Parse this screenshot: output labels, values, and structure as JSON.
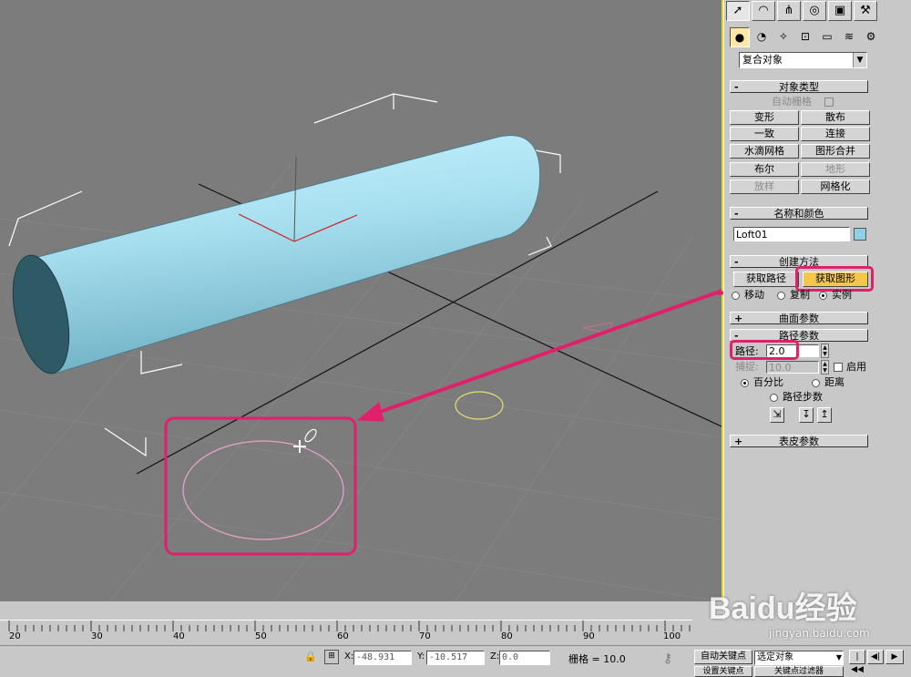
{
  "panel": {
    "tabs": [
      "create-icon",
      "modify-icon",
      "hierarchy-icon",
      "motion-icon",
      "display-icon",
      "utilities-icon"
    ],
    "subcategory_icons": [
      "geometry-icon",
      "shapes-icon",
      "lights-icon",
      "cameras-icon",
      "helpers-icon",
      "spacewarps-icon",
      "systems-icon"
    ],
    "category_dropdown": "复合对象",
    "object_type": {
      "title": "对象类型",
      "auto_grid": "自动栅格",
      "buttons": [
        "变形",
        "散布",
        "一致",
        "连接",
        "水滴网格",
        "图形合并",
        "布尔",
        "地形",
        "放样",
        "网格化"
      ]
    },
    "name_color": {
      "title": "名称和颜色",
      "name_value": "Loft01",
      "color": "#8fd0e8"
    },
    "creation_method": {
      "title": "创建方法",
      "get_path": "获取路径",
      "get_shape": "获取图形",
      "move": "移动",
      "copy": "复制",
      "instance": "实例"
    },
    "surface_params": {
      "title": "曲面参数"
    },
    "path_params": {
      "title": "路径参数",
      "path_label": "路径:",
      "path_value": "2.0",
      "snap_label": "捕捉:",
      "snap_value": "10.0",
      "enable": "启用",
      "percentage": "百分比",
      "distance": "距离",
      "path_steps": "路径步数"
    },
    "skin_params": {
      "title": "表皮参数"
    }
  },
  "ruler": {
    "ticks": [
      "20",
      "30",
      "40",
      "50",
      "60",
      "70",
      "80",
      "90",
      "100"
    ]
  },
  "status": {
    "x_label": "X:",
    "x_value": "-48.931",
    "y_label": "Y:",
    "y_value": "-10.517",
    "z_label": "Z:",
    "z_value": "0.0",
    "grid": "栅格 = 10.0",
    "auto_key": "自动关键点",
    "set_key": "设置关键点",
    "selection_dropdown": "选定对象",
    "key_filters": "关键点过滤器"
  },
  "colors": {
    "highlight": "#e0206a",
    "viewport_border": "#e8d830",
    "cylinder": "#a8e0f0"
  },
  "watermark": {
    "logo": "Baidu经验",
    "url": "jingyan.baidu.com"
  }
}
